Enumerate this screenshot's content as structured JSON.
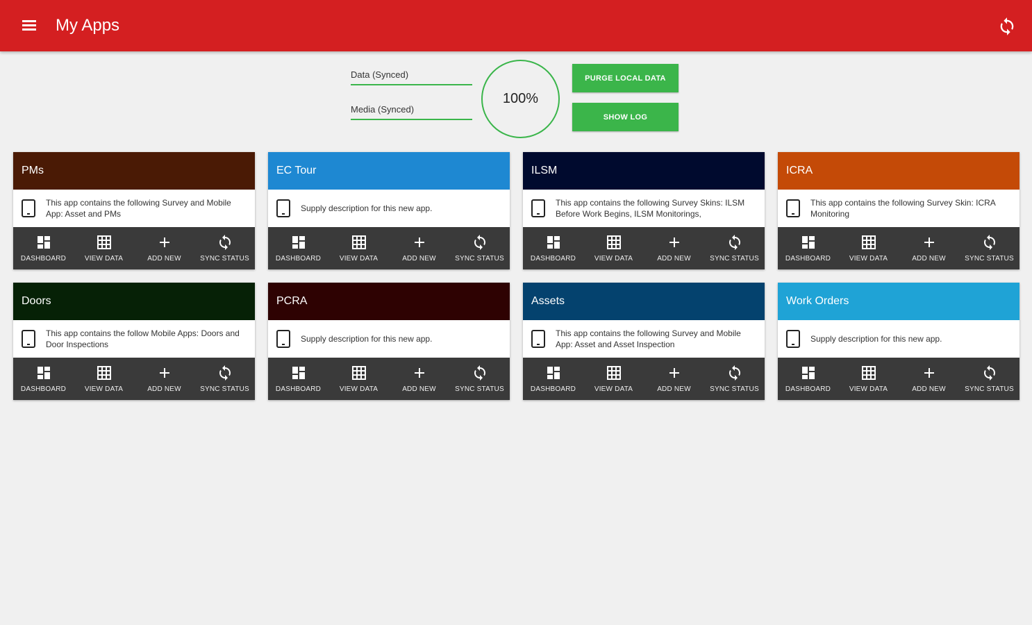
{
  "appbar": {
    "title": "My Apps",
    "menu_icon": "menu-icon",
    "sync_icon": "sync-icon",
    "color": "#d41f21"
  },
  "sync_panel": {
    "data_label": "Data (Synced)",
    "media_label": "Media (Synced)",
    "progress": "100%",
    "purge_label": "PURGE LOCAL DATA",
    "log_label": "SHOW LOG",
    "accent": "#3bb54a"
  },
  "actions": {
    "dashboard": "DASHBOARD",
    "view_data": "VIEW DATA",
    "add_new": "ADD NEW",
    "sync_status": "SYNC STATUS"
  },
  "apps": [
    {
      "title": "PMs",
      "color": "#4a1a05",
      "description": "This app contains the following Survey and Mobile App: Asset and PMs"
    },
    {
      "title": "EC Tour",
      "color": "#1e88d2",
      "description": "Supply description for this new app."
    },
    {
      "title": "ILSM",
      "color": "#000a2e",
      "description": "This app contains the following Survey Skins: ILSM Before Work Begins, ILSM Monitorings,"
    },
    {
      "title": "ICRA",
      "color": "#c44a07",
      "description": "This app contains the following Survey Skin: ICRA Monitoring"
    },
    {
      "title": "Doors",
      "color": "#062106",
      "description": "This app contains the follow Mobile Apps: Doors and Door Inspections"
    },
    {
      "title": "PCRA",
      "color": "#2e0202",
      "description": "Supply description for this new app."
    },
    {
      "title": "Assets",
      "color": "#04426e",
      "description": "This app contains the following Survey and Mobile App: Asset and Asset Inspection"
    },
    {
      "title": "Work Orders",
      "color": "#1fa3d6",
      "description": "Supply description for this new app."
    }
  ]
}
